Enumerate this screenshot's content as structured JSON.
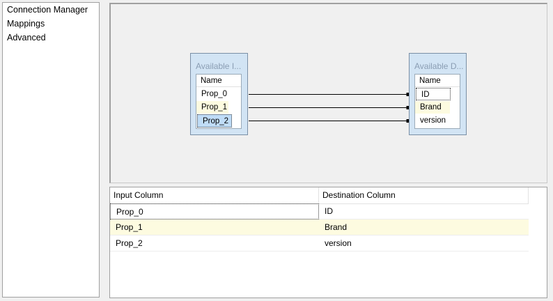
{
  "nav": {
    "items": [
      "Connection Manager",
      "Mappings",
      "Advanced"
    ]
  },
  "mapping": {
    "source_box": {
      "title": "Available I...",
      "header": "Name",
      "items": [
        "Prop_0",
        "Prop_1",
        "Prop_2"
      ]
    },
    "dest_box": {
      "title": "Available D...",
      "header": "Name",
      "items": [
        "ID",
        "Brand",
        "version"
      ]
    }
  },
  "grid": {
    "headers": [
      "Input Column",
      "Destination Column"
    ],
    "rows": [
      {
        "input": "Prop_0",
        "destination": "ID"
      },
      {
        "input": "Prop_1",
        "destination": "Brand"
      },
      {
        "input": "Prop_2",
        "destination": "version"
      }
    ]
  },
  "colors": {
    "canvas_bg": "#f0f0f0",
    "box_bg": "#d2e4f4",
    "row_highlight": "#fdfbe0",
    "row_selected": "#bfdcf7"
  }
}
